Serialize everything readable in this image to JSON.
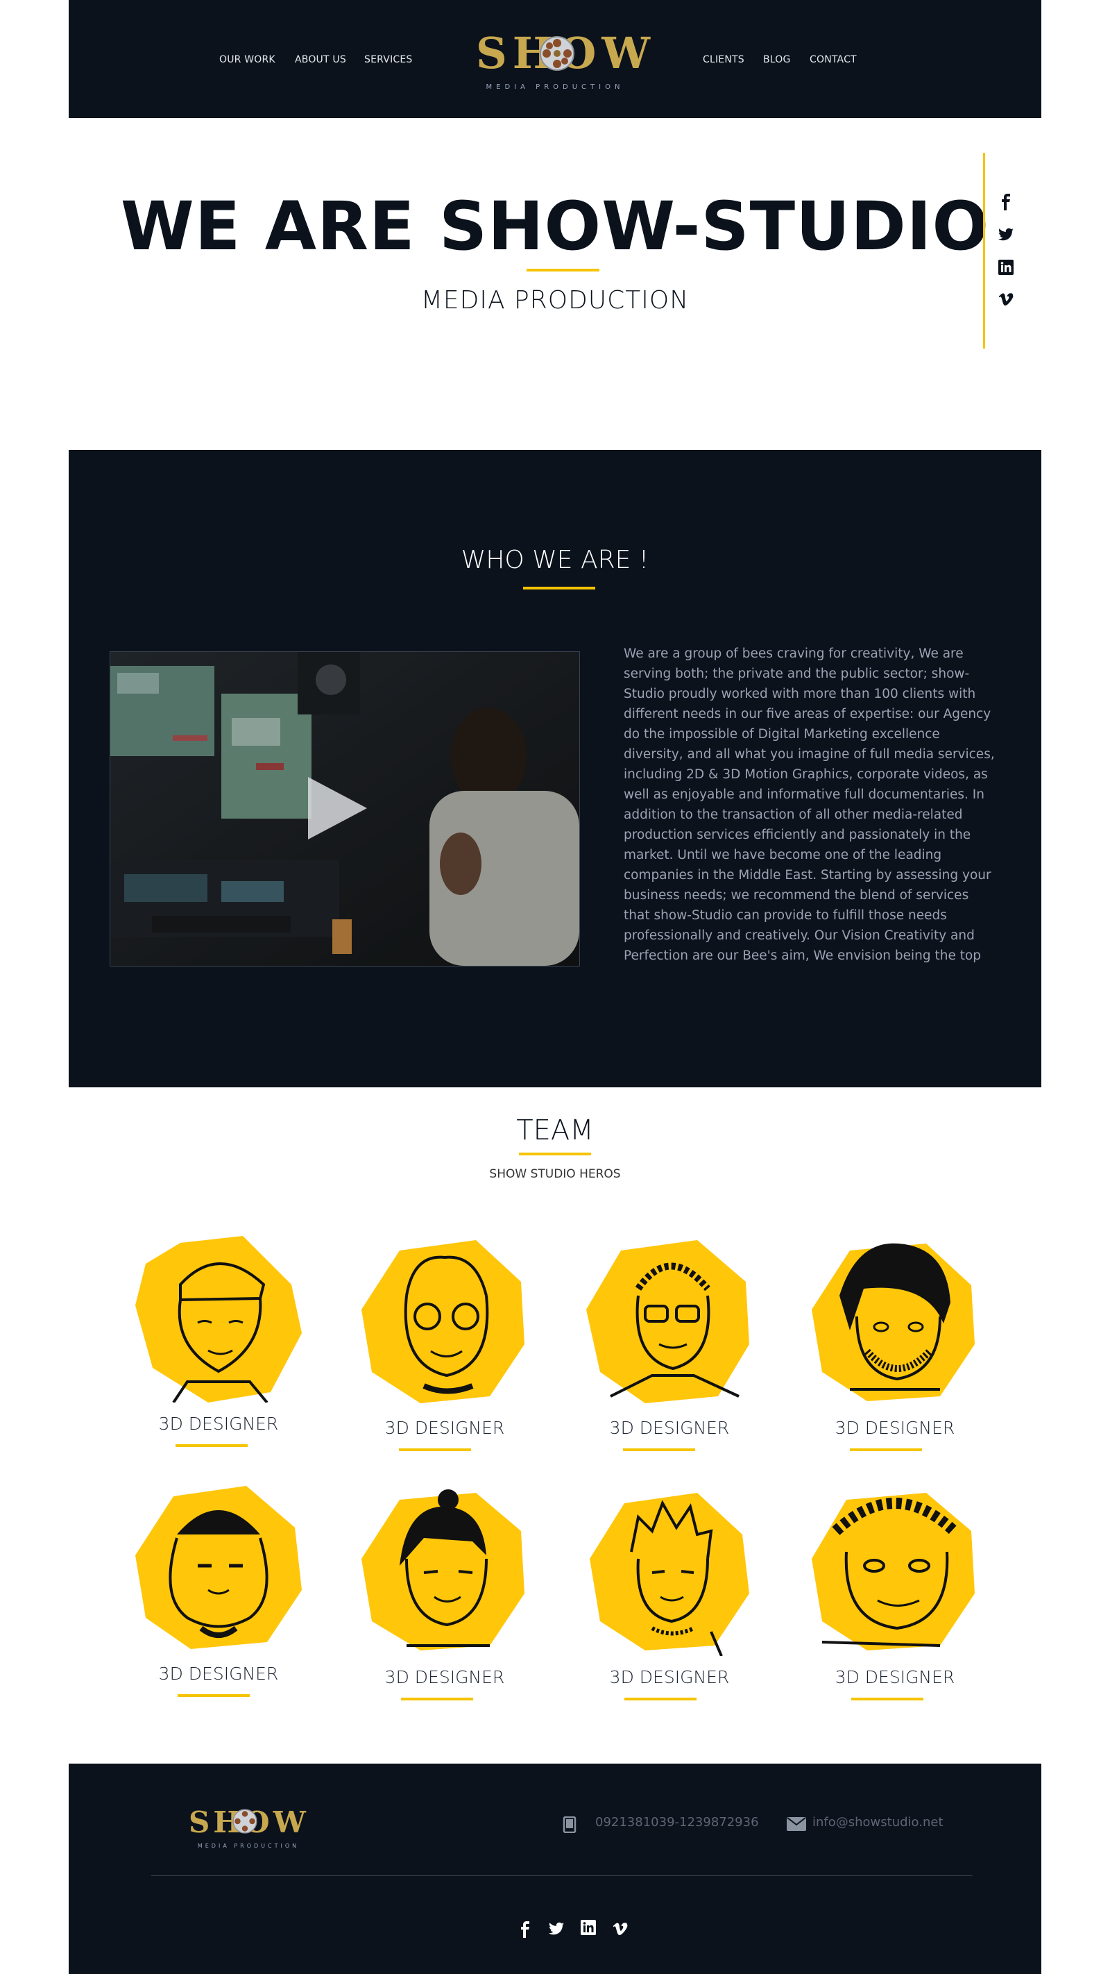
{
  "header": {
    "nav_left": [
      "OUR WORK",
      "ABOUT US",
      "SERVICES"
    ],
    "nav_right": [
      "CLIENTS",
      "BLOG",
      "CONTACT"
    ],
    "logo_word": "SHOW",
    "logo_sub": "MEDIA PRODUCTION"
  },
  "hero": {
    "title": "WE ARE SHOW-STUDIO",
    "subtitle": "MEDIA  PRODUCTION"
  },
  "social": [
    "facebook-icon",
    "twitter-icon",
    "linkedin-icon",
    "vimeo-icon"
  ],
  "about": {
    "title": "WHO WE ARE !",
    "text": "We are a group of bees craving for creativity, We are serving both; the private and the public sector; show-Studio proudly worked with more than 100 clients with different needs in our five areas of expertise: our Agency do the impossible of Digital Marketing excellence diversity, and all what you imagine of full media services, including 2D & 3D Motion Graphics, corporate videos, as well as enjoyable and informative full documentaries. In addition to the transaction of all other media-related production services efficiently and passionately in the market. Until we have become one of the leading companies in the Middle East. Starting by assessing your business needs; we recommend the blend of services that show-Studio can provide to fulfill those needs professionally and creatively. Our Vision Creativity and Perfection are our Bee's aim, We envision being the top leaders of Advertising Agencies in"
  },
  "team": {
    "title": "TEAM",
    "subtitle": "SHOW STUDIO HEROS",
    "members": [
      {
        "role": "3D DESIGNER"
      },
      {
        "role": "3D DESIGNER"
      },
      {
        "role": "3D DESIGNER"
      },
      {
        "role": "3D DESIGNER"
      },
      {
        "role": "3D DESIGNER"
      },
      {
        "role": "3D DESIGNER"
      },
      {
        "role": "3D DESIGNER"
      },
      {
        "role": "3D DESIGNER"
      }
    ]
  },
  "footer": {
    "logo_word": "SHOW",
    "logo_sub": "MEDIA PRODUCTION",
    "phone": "0921381039-1239872936",
    "email": "info@showstudio.net"
  },
  "colors": {
    "dark": "#0b121c",
    "accent": "#f5c400",
    "gold": "#c8a84f"
  }
}
